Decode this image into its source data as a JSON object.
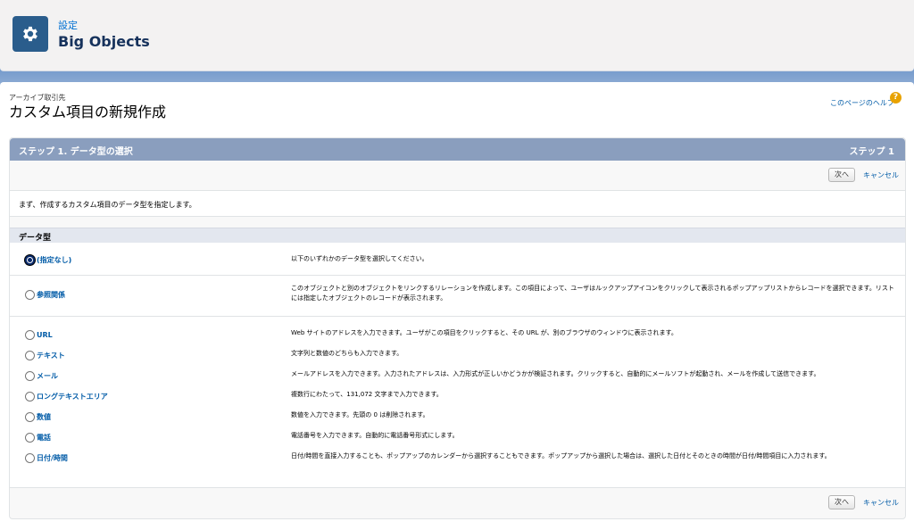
{
  "header": {
    "breadcrumb": "設定",
    "title": "Big Objects",
    "icon": "gear-icon"
  },
  "page": {
    "object_label": "アーカイブ取引先",
    "title": "カスタム項目の新規作成",
    "help_link": "このページのヘルプ",
    "help_icon": "?"
  },
  "panel": {
    "title": "ステップ 1. データ型の選択",
    "step": "ステップ 1",
    "next_label": "次へ",
    "cancel_label": "キャンセル",
    "intro": "まず、作成するカスタム項目のデータ型を指定します。",
    "section_title": "データ型"
  },
  "data_types": [
    {
      "label": "(指定なし)",
      "checked": true,
      "description": "以下のいずれかのデータ型を選択してください。"
    },
    {
      "label": "参照関係",
      "checked": false,
      "description": "このオブジェクトと別のオブジェクトをリンクするリレーションを作成します。この項目によって、ユーザはルックアップアイコンをクリックして表示されるポップアップリストからレコードを選択できます。リストには指定したオブジェクトのレコードが表示されます。"
    },
    {
      "label": "URL",
      "checked": false,
      "description": "Web サイトのアドレスを入力できます。ユーザがこの項目をクリックすると、その URL が、別のブラウザのウィンドウに表示されます。"
    },
    {
      "label": "テキスト",
      "checked": false,
      "description": "文字列と数値のどちらも入力できます。"
    },
    {
      "label": "メール",
      "checked": false,
      "description": "メールアドレスを入力できます。入力されたアドレスは、入力形式が正しいかどうかが検証されます。クリックすると、自動的にメールソフトが起動され、メールを作成して送信できます。"
    },
    {
      "label": "ロングテキストエリア",
      "checked": false,
      "description": "複数行にわたって、131,072 文字まで入力できます。"
    },
    {
      "label": "数値",
      "checked": false,
      "description": "数値を入力できます。先頭の 0 は削除されます。"
    },
    {
      "label": "電話",
      "checked": false,
      "description": "電話番号を入力できます。自動的に電話番号形式にします。"
    },
    {
      "label": "日付/時間",
      "checked": false,
      "description": "日付/時間を直接入力することも、ポップアップのカレンダーから選択することもできます。ポップアップから選択した場合は、選択した日付とそのときの時間が日付/時間項目に入力されます。"
    }
  ]
}
